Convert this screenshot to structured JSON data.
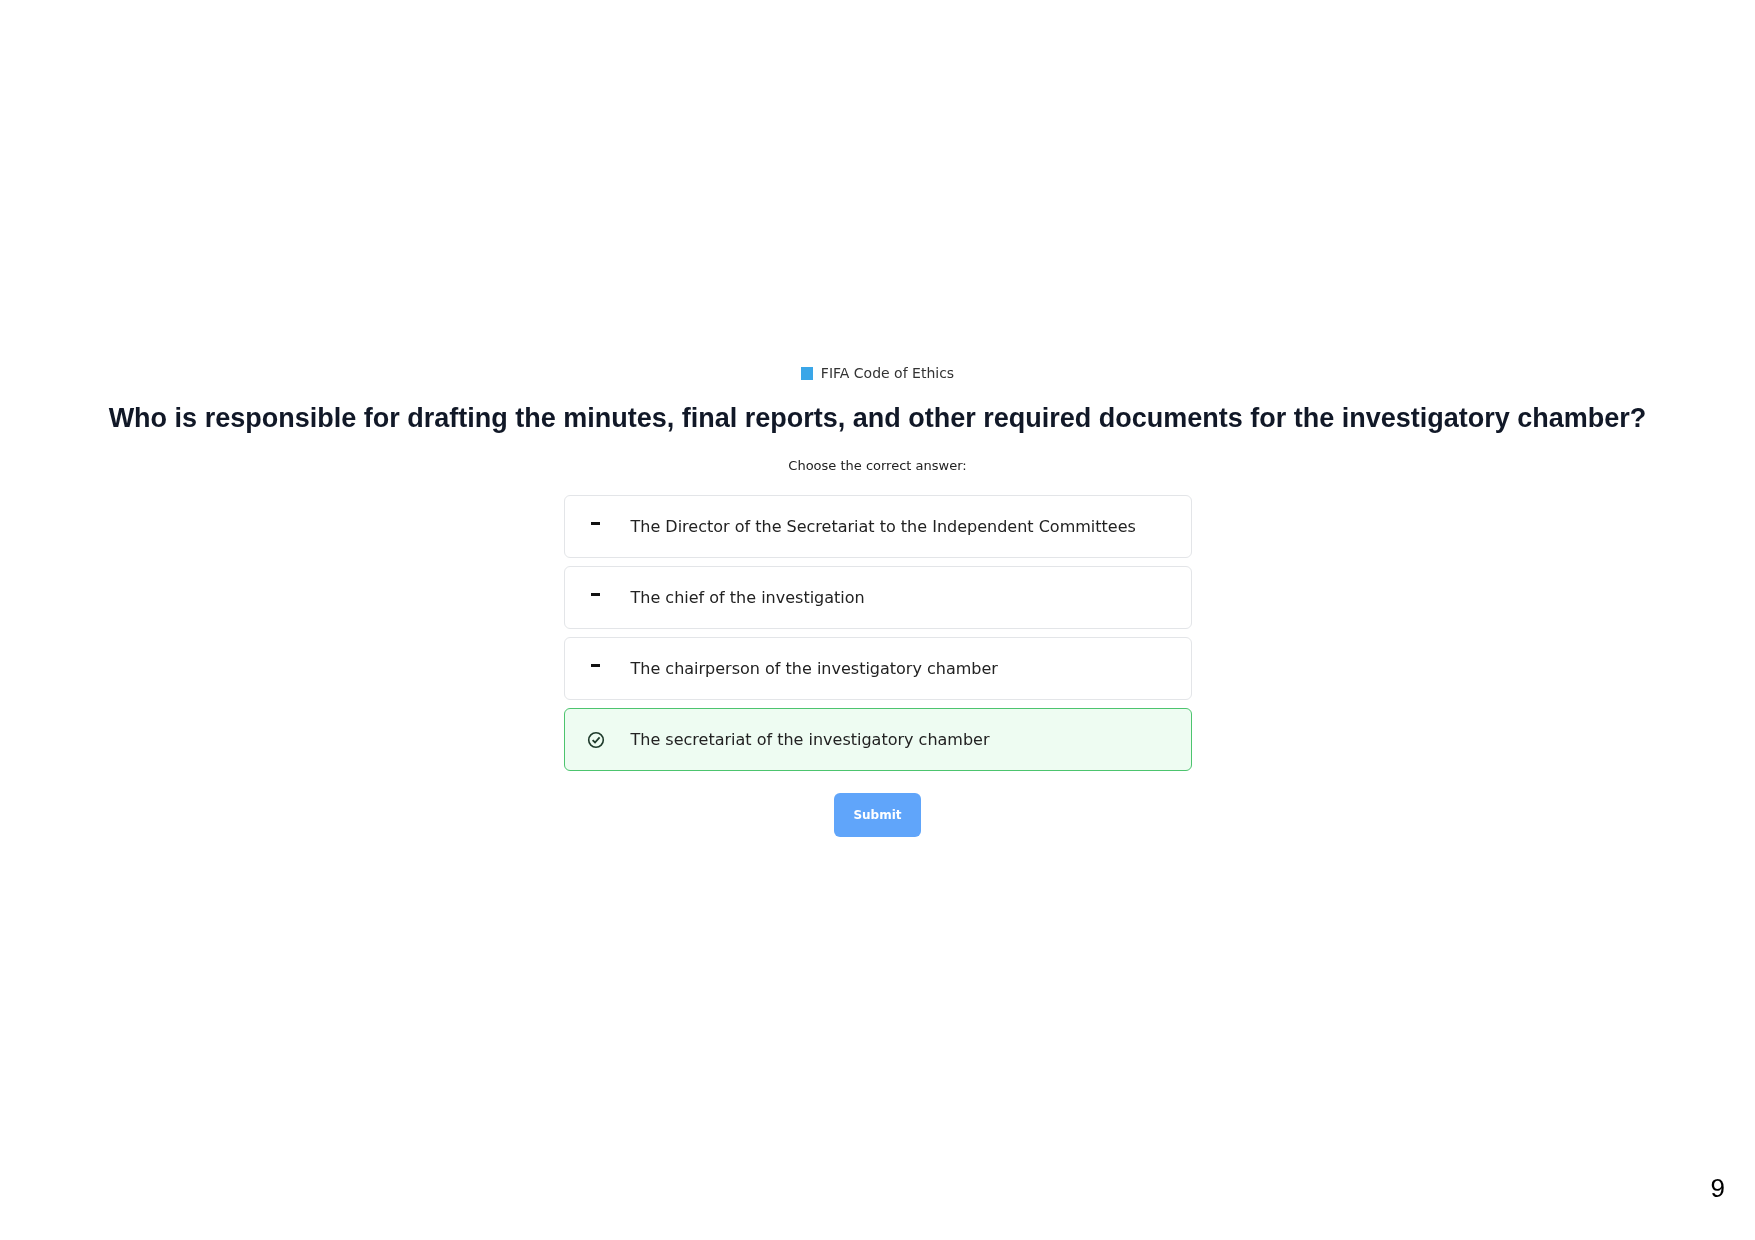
{
  "source": {
    "label": "FIFA Code of Ethics"
  },
  "question": "Who is responsible for drafting the minutes, final reports, and other required documents for the investigatory chamber?",
  "instruction": "Choose the correct answer:",
  "options": [
    {
      "text": "The Director of the Secretariat to the Independent Committees",
      "selected": false
    },
    {
      "text": "The chief of the investigation",
      "selected": false
    },
    {
      "text": "The chairperson of the investigatory chamber",
      "selected": false
    },
    {
      "text": "The secretariat of the investigatory chamber",
      "selected": true
    }
  ],
  "submit_button": "Submit",
  "page_number": "9"
}
